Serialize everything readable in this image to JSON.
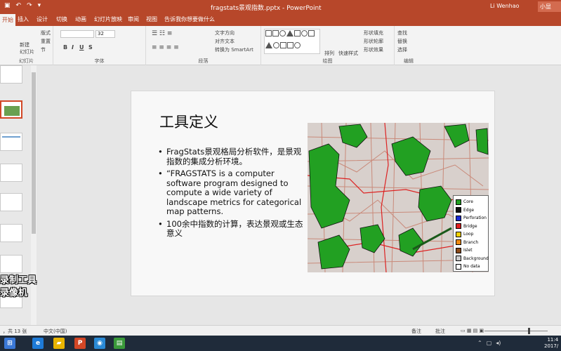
{
  "titlebar": {
    "doc_title": "fragstats景观指数.pptx - PowerPoint",
    "user": "Li Wenhao",
    "share": "小显"
  },
  "tabs": [
    {
      "label": "开始",
      "active": true
    },
    {
      "label": "插入"
    },
    {
      "label": "设计"
    },
    {
      "label": "切换"
    },
    {
      "label": "动画"
    },
    {
      "label": "幻灯片放映"
    },
    {
      "label": "审阅"
    },
    {
      "label": "视图"
    },
    {
      "label": "告诉我你想要做什么"
    }
  ],
  "ribbon": {
    "slides_group": {
      "label": "幻灯片",
      "new_slide": "新建\n幻灯片",
      "layout": "版式",
      "reset": "重置",
      "section": "节"
    },
    "font_group": {
      "label": "字体",
      "font_size": "32"
    },
    "paragraph_group": {
      "label": "段落",
      "text_direction": "文字方向",
      "align_text": "对齐文本",
      "smartart": "转换为 SmartArt"
    },
    "drawing_group": {
      "label": "绘图",
      "arrange": "排列",
      "quick_styles": "快速样式",
      "shape_fill": "形状填充",
      "shape_outline": "形状轮廓",
      "shape_effects": "形状效果"
    },
    "editing_group": {
      "label": "编辑",
      "find": "查找",
      "replace": "替换",
      "select": "选择"
    }
  },
  "overlay": {
    "line1": "录制工具",
    "line2": "录像机"
  },
  "slide": {
    "title": "工具定义",
    "bullets": [
      "FragStats景观格局分析软件，是景观指数的集成分析环境。",
      "“FRAGSTATS is a computer software program designed to compute a wide variety of landscape metrics for categorical map patterns.",
      "100余中指数的计算，表达景观或生态意义"
    ],
    "legend": [
      {
        "label": "Core",
        "color": "#22a022"
      },
      {
        "label": "Edge",
        "color": "#111111"
      },
      {
        "label": "Perforation",
        "color": "#1a2bd6"
      },
      {
        "label": "Bridge",
        "color": "#e02020"
      },
      {
        "label": "Loop",
        "color": "#f2d000"
      },
      {
        "label": "Branch",
        "color": "#f08a10"
      },
      {
        "label": "Islet",
        "color": "#8a4a1a"
      },
      {
        "label": "Background",
        "color": "#cccccc"
      },
      {
        "label": "No data",
        "color": "#ffffff"
      }
    ]
  },
  "statusbar": {
    "slide_count": "，共 13 张",
    "language": "中文(中国)",
    "notes": "备注",
    "comments": "批注"
  },
  "taskbar": {
    "clock_time": "11:4",
    "clock_date": "2017/"
  }
}
